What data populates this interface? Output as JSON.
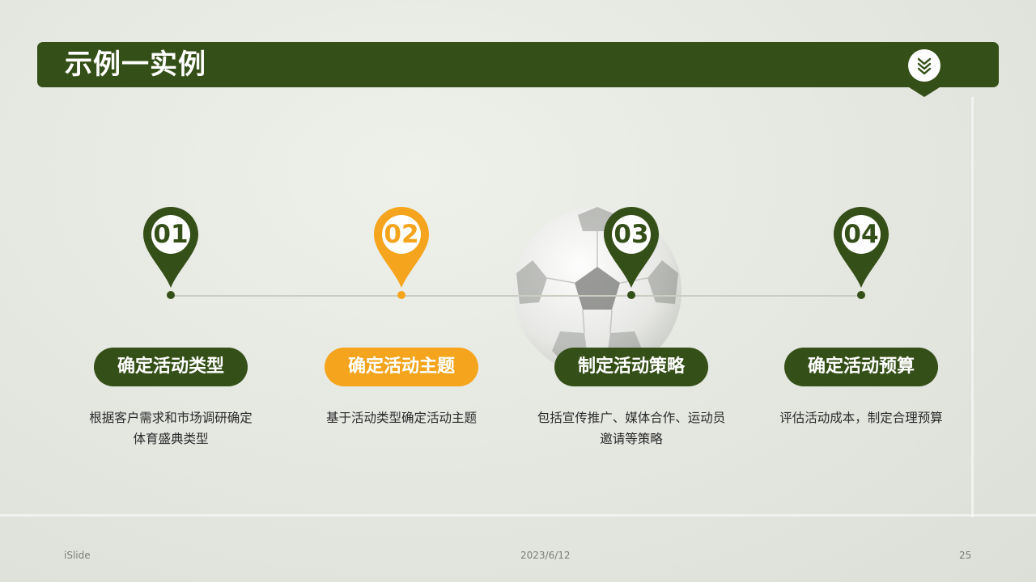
{
  "header": {
    "title": "示例一实例",
    "badge_icon": "double-chevron-down-icon"
  },
  "colors": {
    "primary_green": "#344f17",
    "accent_orange": "#f5a41d",
    "white": "#ffffff"
  },
  "steps": [
    {
      "number": "01",
      "title": "确定活动类型",
      "description": "根据客户需求和市场调研确定体育盛典类型",
      "color": "#344f17"
    },
    {
      "number": "02",
      "title": "确定活动主题",
      "description": "基于活动类型确定活动主题",
      "color": "#f5a41d"
    },
    {
      "number": "03",
      "title": "制定活动策略",
      "description": "包括宣传推广、媒体合作、运动员邀请等策略",
      "color": "#344f17"
    },
    {
      "number": "04",
      "title": "确定活动预算",
      "description": "评估活动成本，制定合理预算",
      "color": "#344f17"
    }
  ],
  "footer": {
    "left": "iSlide",
    "center": "2023/6/12",
    "right": "25"
  }
}
